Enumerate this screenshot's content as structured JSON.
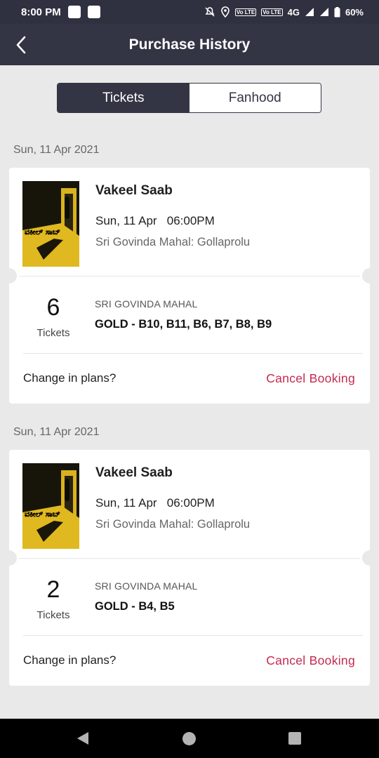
{
  "status_bar": {
    "time": "8:00 PM",
    "network": "4G",
    "battery": "60%"
  },
  "header": {
    "title": "Purchase History"
  },
  "tabs": [
    {
      "label": "Tickets",
      "active": true
    },
    {
      "label": "Fanhood",
      "active": false
    }
  ],
  "bookings": [
    {
      "date_header": "Sun, 11 Apr 2021",
      "movie": "Vakeel Saab",
      "show_date": "Sun, 11 Apr",
      "show_time": "06:00PM",
      "venue": "Sri Govinda Mahal: Gollaprolu",
      "ticket_count": "6",
      "tickets_label": "Tickets",
      "theatre": "SRI GOVINDA MAHAL",
      "seats": "GOLD - B10, B11, B6, B7, B8, B9",
      "change_plans": "Change in plans?",
      "cancel_label": "Cancel Booking"
    },
    {
      "date_header": "Sun, 11 Apr 2021",
      "movie": "Vakeel Saab",
      "show_date": "Sun, 11 Apr",
      "show_time": "06:00PM",
      "venue": "Sri Govinda Mahal: Gollaprolu",
      "ticket_count": "2",
      "tickets_label": "Tickets",
      "theatre": "SRI GOVINDA MAHAL",
      "seats": "GOLD - B4, B5",
      "change_plans": "Change in plans?",
      "cancel_label": "Cancel Booking"
    }
  ],
  "colors": {
    "header_bg": "#333545",
    "accent_cancel": "#c4294f",
    "page_bg": "#e9e9e9"
  }
}
